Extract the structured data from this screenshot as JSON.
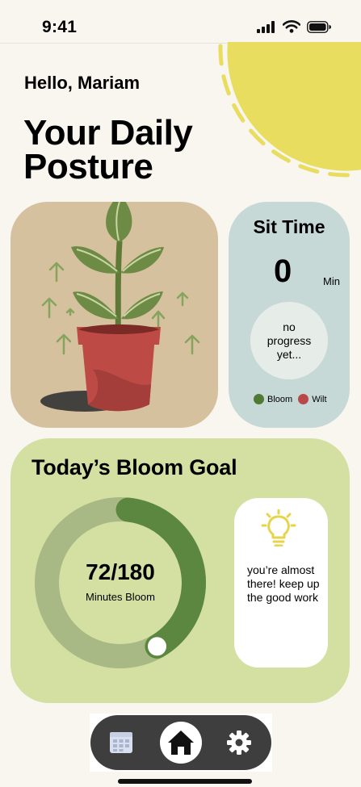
{
  "status_bar": {
    "time": "9:41"
  },
  "greeting": "Hello, Mariam",
  "heading": {
    "line1": "Your Daily",
    "line2": "Posture"
  },
  "sit_time": {
    "title": "Sit Time",
    "value": "0",
    "unit": "Min",
    "progress_text": "no progress yet...",
    "legend": [
      {
        "label": "Bloom",
        "color": "#4e7a33"
      },
      {
        "label": "Wilt",
        "color": "#b94848"
      }
    ]
  },
  "bloom_goal": {
    "title": "Today’s Bloom Goal",
    "value_text": "72/180",
    "label": "Minutes Bloom",
    "progress": 0.4,
    "tip": "you’re almost there! keep up the good work"
  },
  "nav": {
    "items": [
      "calendar-icon",
      "home-icon",
      "gear-icon"
    ],
    "active": "home-icon"
  },
  "colors": {
    "background": "#f8f6ee",
    "sun": "#e8dd5f",
    "plant_card": "#d6c19f",
    "sit_card": "#c6d9d7",
    "bloom_card": "#d3e0a2",
    "ring_progress": "#5c8741",
    "ring_track": "#a9b985",
    "nav": "#3e3e3e"
  }
}
